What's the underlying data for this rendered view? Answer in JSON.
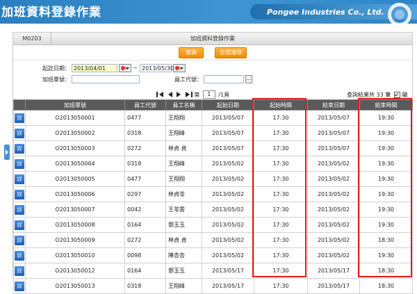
{
  "banner": {
    "title": "加班資料登錄作業",
    "company": "Pongee Industries Co., Ltd."
  },
  "form": {
    "code": "M0203",
    "title": "加班資料登錄作業",
    "query_button": "查詢",
    "clear_button": "全部清除",
    "start_date_label": "起訖日期：",
    "start_date_value": "2013/04/01",
    "range_separator": "~",
    "end_date_value": "2013/05/30",
    "form_no_label": "加班單號：",
    "form_no_value": "",
    "employee_id_label": "員工代號：",
    "employee_id_value": "",
    "browse_button": "..."
  },
  "pager": {
    "prefix": "第",
    "page": "1",
    "suffix": "/1頁",
    "result_text": "查詢結果共 33 筆",
    "show_all_label": "顯示全部",
    "show_all_checked": true
  },
  "table": {
    "detail_label": "詳",
    "headers": [
      "",
      "加班單號",
      "員工代號",
      "員工名稱",
      "起始日期",
      "起始時間",
      "結束日期",
      "結束時間"
    ],
    "rows": [
      [
        "O2013050001",
        "0477",
        "王翔翔",
        "2013/05/07",
        "17:30",
        "2013/05/07",
        "19:30"
      ],
      [
        "O2013050002",
        "0318",
        "王翔峰",
        "2013/05/07",
        "17:30",
        "2013/05/07",
        "19:30"
      ],
      [
        "O2013050003",
        "0272",
        "林貞 貞",
        "2013/05/07",
        "17:30",
        "2013/05/07",
        "19:30"
      ],
      [
        "O2013050004",
        "0318",
        "王翔峰",
        "2013/05/02",
        "17:30",
        "2013/05/02",
        "19:30"
      ],
      [
        "O2013050005",
        "0477",
        "王翔翔",
        "2013/05/02",
        "17:30",
        "2013/05/02",
        "19:30"
      ],
      [
        "O2013050006",
        "0297",
        "林貞苓",
        "2013/05/02",
        "17:30",
        "2013/05/02",
        "19:30"
      ],
      [
        "O2013050007",
        "0042",
        "王苓雲",
        "2013/05/02",
        "17:30",
        "2013/05/02",
        "19:30"
      ],
      [
        "O2013050008",
        "0164",
        "鄧玉玉",
        "2013/05/02",
        "17:30",
        "2013/05/02",
        "19:30"
      ],
      [
        "O2013050009",
        "0272",
        "林貞 貞",
        "2013/05/02",
        "17:30",
        "2013/05/02",
        "18:30"
      ],
      [
        "O2013050010",
        "0098",
        "陳杏杏",
        "2013/05/02",
        "17:30",
        "2013/05/02",
        "19:30"
      ],
      [
        "O2013050012",
        "0164",
        "鄧玉玉",
        "2013/05/17",
        "17:30",
        "2013/05/17",
        "18:30"
      ],
      [
        "O2013050013",
        "0318",
        "王翔峰",
        "2013/05/17",
        "17:30",
        "2013/05/17",
        "18:30"
      ]
    ]
  },
  "colors": {
    "banner": "#2a7fc0",
    "button": "#f08a00",
    "header": "#5a5a5a",
    "highlight": "#e01b1b"
  }
}
